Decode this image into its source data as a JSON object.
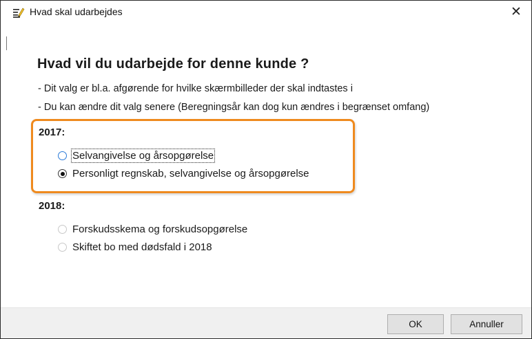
{
  "window": {
    "title": "Hvad skal udarbejdes",
    "close_symbol": "✕"
  },
  "heading": "Hvad vil du udarbejde for denne kunde ?",
  "info": [
    "- Dit valg er bl.a. afgørende for hvilke skærmbilleder der skal indtastes i",
    "- Du kan ændre dit valg senere (Beregningsår kan dog kun ændres i begrænset omfang)"
  ],
  "groups": [
    {
      "title": "2017:",
      "options": [
        {
          "label": "Selvangivelse og årsopgørelse",
          "selected": false,
          "enabled": true
        },
        {
          "label": "Personligt regnskab, selvangivelse og årsopgørelse",
          "selected": true,
          "enabled": true
        }
      ]
    },
    {
      "title": "2018:",
      "options": [
        {
          "label": "Forskudsskema og forskudsopgørelse",
          "selected": false,
          "enabled": false
        },
        {
          "label": "Skiftet bo med dødsfald i 2018",
          "selected": false,
          "enabled": false
        }
      ]
    }
  ],
  "buttons": {
    "ok": "OK",
    "cancel": "Annuller"
  },
  "colors": {
    "highlight": "#ef8a1e",
    "radio_focus": "#2a7ad8",
    "footer_bg": "#f0f0f0"
  },
  "icons": {
    "app": "edit-document-icon",
    "close": "close-icon"
  }
}
